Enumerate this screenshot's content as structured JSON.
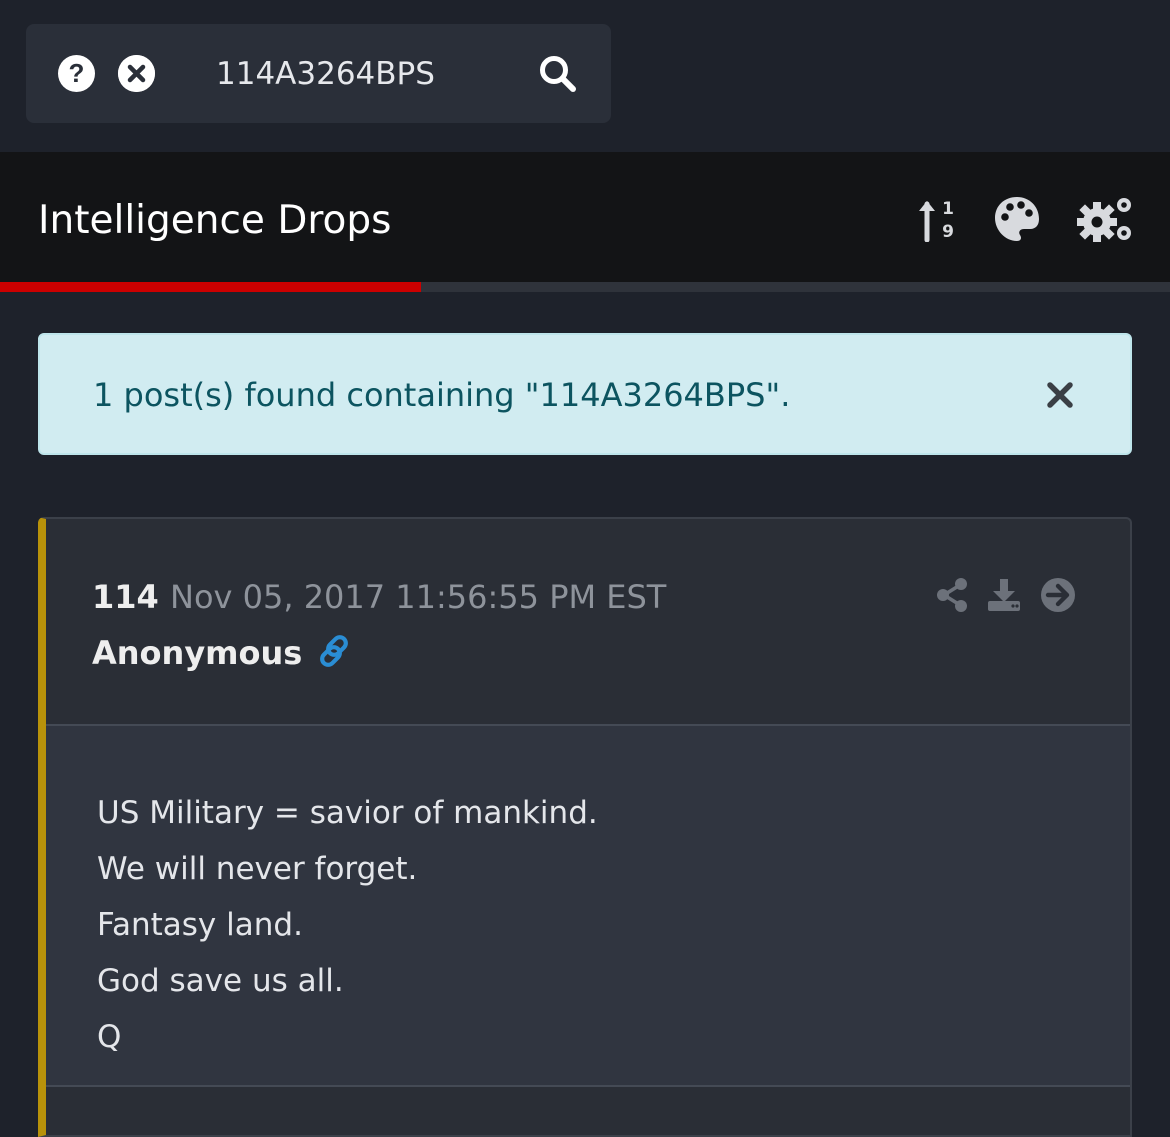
{
  "search": {
    "value": "114A3264BPS",
    "help_icon": "question-circle-icon",
    "clear_icon": "times-circle-icon",
    "submit_icon": "search-icon"
  },
  "header": {
    "title": "Intelligence Drops",
    "icons": [
      "sort-numeric-icon",
      "palette-icon",
      "cogs-icon"
    ]
  },
  "progress": {
    "fraction": 0.36,
    "color": "#cc0000"
  },
  "alert": {
    "message": "1 post(s) found containing \"114A3264BPS\".",
    "close_icon": "times-icon",
    "background": "#d1ecf1",
    "text_color": "#0c5460"
  },
  "post": {
    "number": "114",
    "timestamp": "Nov 05, 2017 11:56:55 PM EST",
    "author": "Anonymous",
    "author_link_icon": "link-icon",
    "actions": [
      "share-icon",
      "download-icon",
      "arrow-circle-right-icon"
    ],
    "accent_color": "#b8920a",
    "lines": [
      "US Military = savior of mankind.",
      "We will never forget.",
      "Fantasy land.",
      "God save us all.",
      "Q"
    ]
  },
  "colors": {
    "page_bg": "#1e222b",
    "header_bg": "#131416",
    "link_blue": "#2a8dd4"
  }
}
